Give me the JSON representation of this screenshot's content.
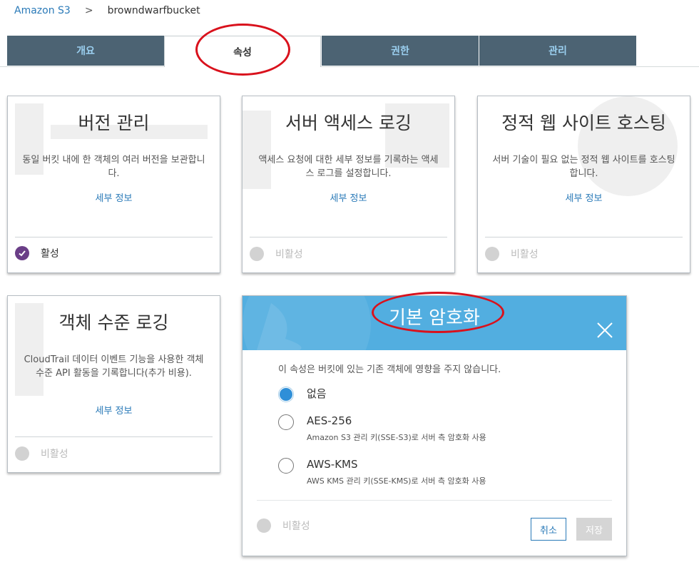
{
  "breadcrumb": {
    "root": "Amazon S3",
    "separator": ">",
    "current": "browndwarfbucket"
  },
  "tabs": [
    {
      "label": "개요",
      "active": false
    },
    {
      "label": "속성",
      "active": true
    },
    {
      "label": "권한",
      "active": false
    },
    {
      "label": "관리",
      "active": false
    }
  ],
  "cards": {
    "versioning": {
      "title": "버전 관리",
      "desc": "동일 버킷 내에 한 객체의 여러 버전을 보관합니다.",
      "link": "세부 정보",
      "status": "활성"
    },
    "server_logging": {
      "title": "서버 액세스 로깅",
      "desc": "액세스 요청에 대한 세부 정보를 기록하는 액세스 로그를 설정합니다.",
      "link": "세부 정보",
      "status": "비활성"
    },
    "static_hosting": {
      "title": "정적 웹 사이트 호스팅",
      "desc": "서버 기술이 필요 없는 정적 웹 사이트를 호스팅합니다.",
      "link": "세부 정보",
      "status": "비활성"
    },
    "object_logging": {
      "title": "객체 수준 로깅",
      "desc": "CloudTrail 데이터 이벤트 기능을 사용한 객체 수준 API 활동을 기록합니다(추가 비용).",
      "link": "세부 정보",
      "status": "비활성"
    }
  },
  "encryption": {
    "title": "기본 암호화",
    "note": "이 속성은 버킷에 있는 기존 객체에 영향을 주지 않습니다.",
    "options": [
      {
        "label": "없음",
        "sub": "",
        "selected": true
      },
      {
        "label": "AES-256",
        "sub": "Amazon S3 관리 키(SSE-S3)로 서버 측 암호화 사용",
        "selected": false
      },
      {
        "label": "AWS-KMS",
        "sub": "AWS KMS 관리 키(SSE-KMS)로 서버 측 암호화 사용",
        "selected": false
      }
    ],
    "status": "비활성",
    "cancel_label": "취소",
    "save_label": "저장"
  },
  "colors": {
    "tab_inactive_bg": "#4c6373",
    "tab_inactive_text": "#9bd0f0",
    "link": "#2a7ab8",
    "header_blue": "#52aee0",
    "active_purple": "#6a3e87",
    "annotation_red": "#d9111c"
  },
  "icons": {
    "check": "check-icon",
    "close": "close-icon"
  }
}
